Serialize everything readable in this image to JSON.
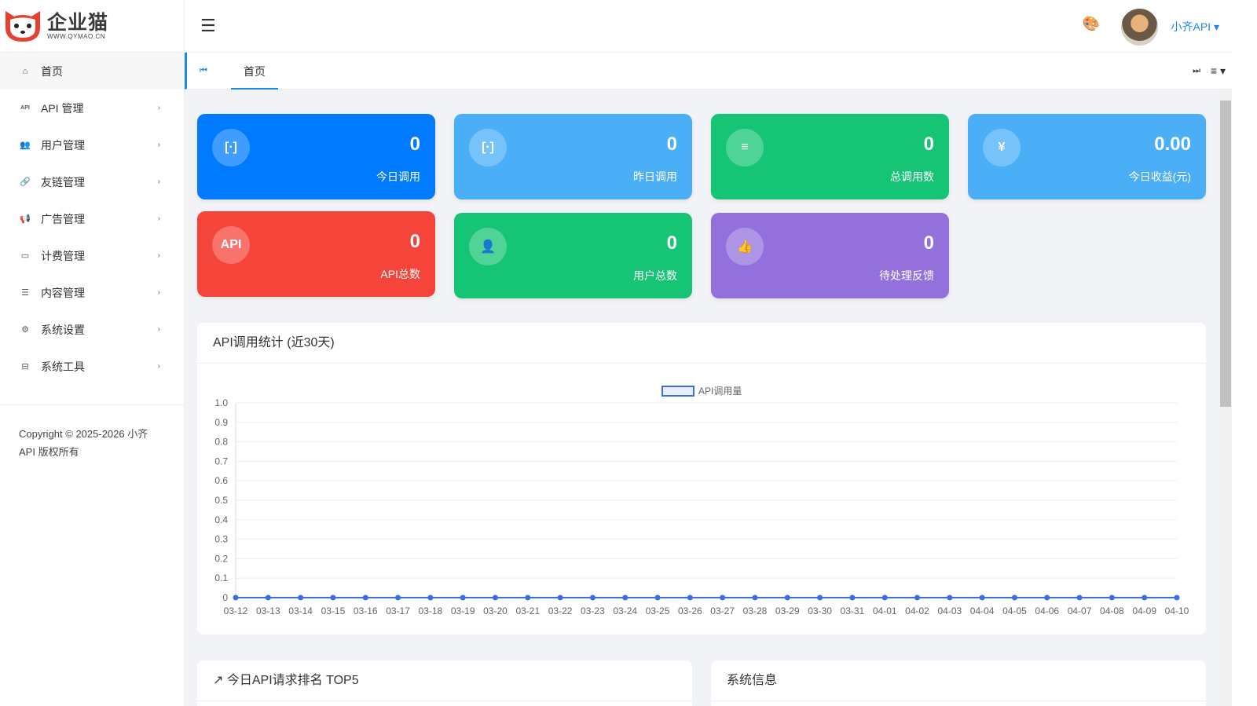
{
  "logo": {
    "name": "企业猫",
    "url": "WWW.QYMAO.CN"
  },
  "sidebar": {
    "items": [
      {
        "label": "首页",
        "icon": "home-icon",
        "glyph": "⌂"
      },
      {
        "label": "API 管理",
        "icon": "api-icon",
        "glyph": "API"
      },
      {
        "label": "用户管理",
        "icon": "users-icon",
        "glyph": "👥"
      },
      {
        "label": "友链管理",
        "icon": "link-icon",
        "glyph": "🔗"
      },
      {
        "label": "广告管理",
        "icon": "bullhorn-icon",
        "glyph": "📢"
      },
      {
        "label": "计费管理",
        "icon": "credit-card-icon",
        "glyph": "▭"
      },
      {
        "label": "内容管理",
        "icon": "document-icon",
        "glyph": "☰"
      },
      {
        "label": "系统设置",
        "icon": "gear-icon",
        "glyph": "⚙"
      },
      {
        "label": "系统工具",
        "icon": "toolbox-icon",
        "glyph": "⊟"
      }
    ],
    "copyright": "Copyright © 2025-2026 小齐 API 版权所有"
  },
  "header": {
    "user": "小齐API"
  },
  "tabs": [
    {
      "label": "首页"
    }
  ],
  "stats": [
    {
      "value": "0",
      "label": "今日调用",
      "color": "#007bff",
      "icon": "bracket-icon",
      "glyph": "[·]"
    },
    {
      "value": "0",
      "label": "昨日调用",
      "color": "#4aaff7",
      "icon": "bracket-icon",
      "glyph": "[·]"
    },
    {
      "value": "0",
      "label": "总调用数",
      "color": "#16c475",
      "icon": "database-icon",
      "glyph": "≡"
    },
    {
      "value": "0.00",
      "label": "今日收益(元)",
      "color": "#4aaff7",
      "icon": "yen-icon",
      "glyph": "¥"
    },
    {
      "value": "0",
      "label": "API总数",
      "color": "#f5443a",
      "icon": "api-icon",
      "glyph": "API"
    },
    {
      "value": "0",
      "label": "用户总数",
      "color": "#16c475",
      "icon": "user-icon",
      "glyph": "👤"
    },
    {
      "value": "0",
      "label": "待处理反馈",
      "color": "#9370db",
      "icon": "thumbs-up-icon",
      "glyph": "👍"
    }
  ],
  "chart_panel": {
    "title": "API调用统计 (近30天)"
  },
  "chart_data": {
    "type": "line",
    "title": "",
    "legend": "API调用量",
    "legend_position": "top",
    "ylim": [
      0,
      1
    ],
    "yticks": [
      "0",
      "0.1",
      "0.2",
      "0.3",
      "0.4",
      "0.5",
      "0.6",
      "0.7",
      "0.8",
      "0.9",
      "1.0"
    ],
    "x": [
      "03-12",
      "03-13",
      "03-14",
      "03-15",
      "03-16",
      "03-17",
      "03-18",
      "03-19",
      "03-20",
      "03-21",
      "03-22",
      "03-23",
      "03-24",
      "03-25",
      "03-26",
      "03-27",
      "03-28",
      "03-29",
      "03-30",
      "03-31",
      "04-01",
      "04-02",
      "04-03",
      "04-04",
      "04-05",
      "04-06",
      "04-07",
      "04-08",
      "04-09",
      "04-10"
    ],
    "series": [
      {
        "name": "API调用量",
        "values": [
          0,
          0,
          0,
          0,
          0,
          0,
          0,
          0,
          0,
          0,
          0,
          0,
          0,
          0,
          0,
          0,
          0,
          0,
          0,
          0,
          0,
          0,
          0,
          0,
          0,
          0,
          0,
          0,
          0,
          0
        ],
        "color": "#3b6fe0"
      }
    ]
  },
  "bottom": {
    "rank_title": "今日API请求排名 TOP5",
    "sys_title": "系统信息"
  }
}
